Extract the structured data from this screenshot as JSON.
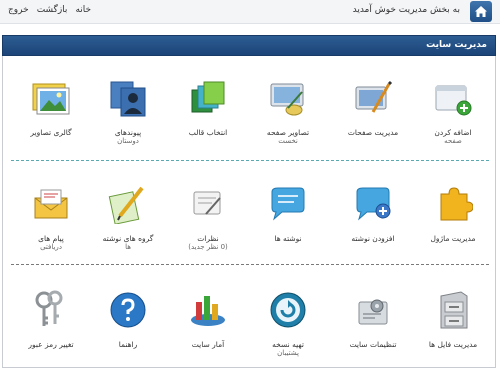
{
  "topbar": {
    "welcome": "به بخش مدیریت خوش آمدید",
    "links": {
      "home": "خانه",
      "back": "بازگشت",
      "logout": "خروج"
    }
  },
  "panel": {
    "title": "مدیریت سایت"
  },
  "tiles": {
    "add_page": {
      "label": "اضافه کردن",
      "sub": "صفحه"
    },
    "manage_pages": {
      "label": "مدیریت صفحات"
    },
    "homepage_images": {
      "label": "تصاویر صفحه",
      "sub": "نخست"
    },
    "choose_template": {
      "label": "انتخاب قالب"
    },
    "friend_links": {
      "label": "پیوندهای",
      "sub": "دوستان"
    },
    "gallery": {
      "label": "گالری تصاویر"
    },
    "module_manage": {
      "label": "مدیریت ماژول"
    },
    "add_post": {
      "label": "افزودن نوشته"
    },
    "posts": {
      "label": "نوشته ها"
    },
    "comments": {
      "label": "نظرات",
      "sub": "(0 نظر جدید)"
    },
    "post_groups": {
      "label": "گروه های نوشته",
      "sub": "ها"
    },
    "messages": {
      "label": "پیام های",
      "sub": "دریافتی"
    },
    "file_manage": {
      "label": "مدیریت فایل ها"
    },
    "site_settings": {
      "label": "تنظیمات سایت"
    },
    "backup": {
      "label": "تهیه نسخه",
      "sub": "پشتیبان"
    },
    "stats": {
      "label": "آمار سایت"
    },
    "guides": {
      "label": "راهنما"
    },
    "change_password": {
      "label": "تغییر رمز عبور"
    }
  },
  "colors": {
    "header_blue": "#1f4a80",
    "separator_teal": "#5aa8b0",
    "separator_gray": "#7a7a7a"
  }
}
